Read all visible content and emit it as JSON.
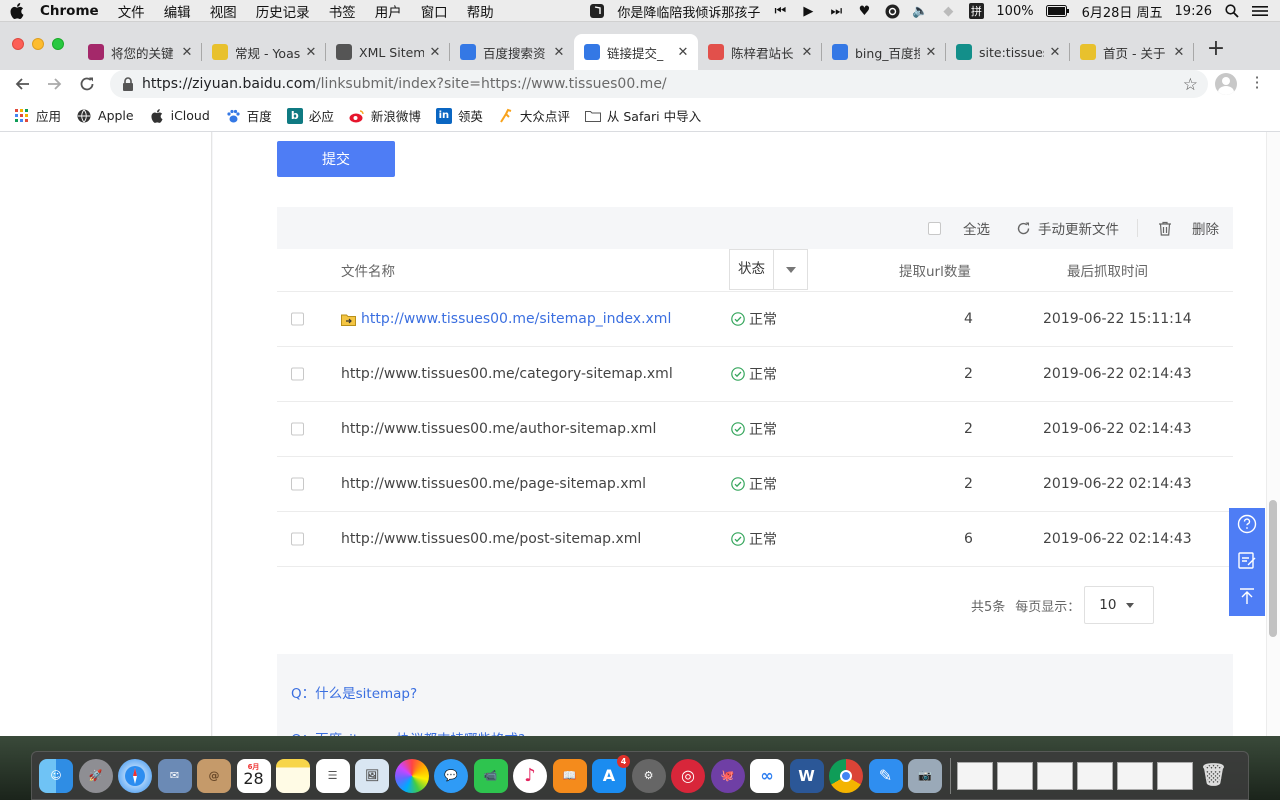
{
  "menubar": {
    "app": "Chrome",
    "items": [
      "文件",
      "编辑",
      "视图",
      "历史记录",
      "书签",
      "用户",
      "窗口",
      "帮助"
    ],
    "now_playing": "你是降临陪我倾诉那孩子",
    "input_method": "拼",
    "battery": "100%",
    "date": "6月28日 周五",
    "time": "19:26"
  },
  "tabs": [
    {
      "title": "将您的关键",
      "favicon": "yoast-icon",
      "color": "#a4286a"
    },
    {
      "title": "常规 - Yoas",
      "favicon": "yoast-seo-icon",
      "color": "#e8c12d"
    },
    {
      "title": "XML Sitem",
      "favicon": "globe-icon",
      "color": "#555555"
    },
    {
      "title": "百度搜索资",
      "favicon": "baidu-paw-icon",
      "color": "#3478e5"
    },
    {
      "title": "链接提交_",
      "favicon": "baidu-paw-icon",
      "color": "#3478e5",
      "active": true
    },
    {
      "title": "陈梓君站长",
      "favicon": "jian-icon",
      "color": "#e2504b"
    },
    {
      "title": "bing_百度搜",
      "favicon": "baidu-paw-icon",
      "color": "#3478e5"
    },
    {
      "title": "site:tissues",
      "favicon": "bing-icon",
      "color": "#138f8a"
    },
    {
      "title": "首页 - 关于",
      "favicon": "yoast-seo-icon",
      "color": "#e8c12d"
    }
  ],
  "omnibox": {
    "host": "https://ziyuan.baidu.com",
    "path": "/linksubmit/index?site=https://www.tissues00.me/"
  },
  "bookmarks": [
    "应用",
    "Apple",
    "iCloud",
    "百度",
    "必应",
    "新浪微博",
    "领英",
    "大众点评",
    "从 Safari 中导入"
  ],
  "page": {
    "submit_label": "提交",
    "toolbar": {
      "select_all": "全选",
      "refresh": "手动更新文件",
      "delete": "删除"
    },
    "headers": {
      "name": "文件名称",
      "status": "状态",
      "count": "提取url数量",
      "time": "最后抓取时间"
    },
    "rows": [
      {
        "name": "http://www.tissues00.me/sitemap_index.xml",
        "status": "正常",
        "count": "4",
        "time": "2019-06-22 15:11:14",
        "link": true
      },
      {
        "name": "http://www.tissues00.me/category-sitemap.xml",
        "status": "正常",
        "count": "2",
        "time": "2019-06-22 02:14:43"
      },
      {
        "name": "http://www.tissues00.me/author-sitemap.xml",
        "status": "正常",
        "count": "2",
        "time": "2019-06-22 02:14:43"
      },
      {
        "name": "http://www.tissues00.me/page-sitemap.xml",
        "status": "正常",
        "count": "2",
        "time": "2019-06-22 02:14:43"
      },
      {
        "name": "http://www.tissues00.me/post-sitemap.xml",
        "status": "正常",
        "count": "6",
        "time": "2019-06-22 02:14:43"
      }
    ],
    "pager": {
      "total": "共5条",
      "per_page_label": "每页显示：",
      "per_page": "10"
    },
    "faq": [
      "Q：什么是sitemap?",
      "Q：百度sitemap协议都支持哪些格式?"
    ]
  },
  "dock": {
    "calendar_day": "28",
    "calendar_month": "6月",
    "appstore_badge": "4"
  }
}
